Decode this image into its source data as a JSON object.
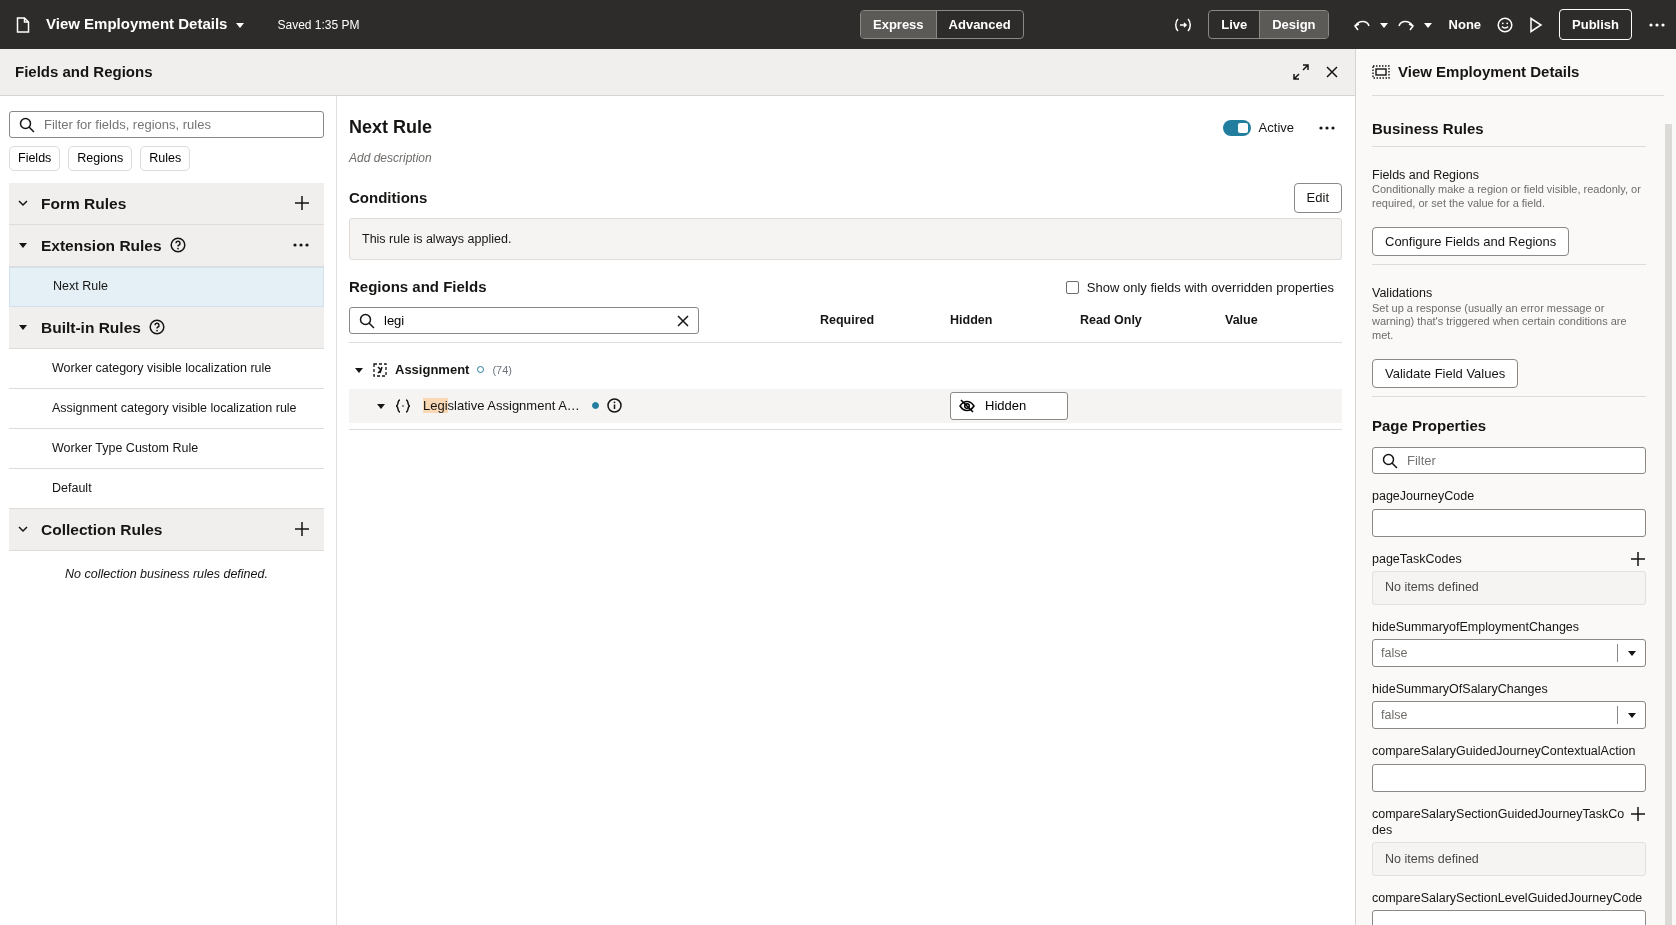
{
  "top_bar": {
    "title": "View Employment Details",
    "saved": "Saved 1:35 PM",
    "modes": [
      {
        "label": "Express",
        "selected": true
      },
      {
        "label": "Advanced",
        "selected": false
      }
    ],
    "views": [
      {
        "label": "Live",
        "selected": false
      },
      {
        "label": "Design",
        "selected": true
      }
    ],
    "language": "None",
    "publish": "Publish"
  },
  "panel": {
    "title": "Fields and Regions"
  },
  "left": {
    "filter_placeholder": "Filter for fields, regions, rules",
    "chips": [
      "Fields",
      "Regions",
      "Rules"
    ],
    "groups": [
      {
        "title": "Form Rules",
        "expanded": true,
        "children": [
          {
            "title": "Extension Rules",
            "expanded": true,
            "help": true,
            "menu": true,
            "items": [
              {
                "label": "Next Rule",
                "selected": true
              }
            ]
          },
          {
            "title": "Built-in Rules",
            "expanded": true,
            "help": true,
            "menu": false,
            "items": [
              {
                "label": "Worker category visible localization rule",
                "selected": false
              },
              {
                "label": "Assignment category visible localization rule",
                "selected": false
              },
              {
                "label": "Worker Type Custom Rule",
                "selected": false
              },
              {
                "label": "Default",
                "selected": false
              }
            ]
          }
        ]
      },
      {
        "title": "Collection Rules",
        "expanded": true,
        "empty": "No collection business rules defined."
      }
    ]
  },
  "center": {
    "title": "Next Rule",
    "active": true,
    "active_label": "Active",
    "description_placeholder": "Add description",
    "conditions_title": "Conditions",
    "edit": "Edit",
    "condition_text": "This rule is always applied.",
    "regions_title": "Regions and Fields",
    "override_label": "Show only fields with overridden properties",
    "override_checked": false,
    "search_value": "legi",
    "columns": [
      "Required",
      "Hidden",
      "Read Only",
      "Value"
    ],
    "tree": [
      {
        "label": "Assignment",
        "count": "(74)",
        "expanded": true,
        "overridden": false,
        "children": [
          {
            "label_match": "Legi",
            "label_rest": "slative Assignment A…",
            "expanded": true,
            "overridden": true,
            "hidden_button": "Hidden"
          }
        ]
      }
    ]
  },
  "right": {
    "title": "View Employment Details",
    "business_rules": "Business Rules",
    "sections": [
      {
        "title": "Fields and Regions",
        "description": "Conditionally make a region or field visible, readonly, or required, or set the value for a field.",
        "button": "Configure Fields and Regions"
      },
      {
        "title": "Validations",
        "description": "Set up a response (usually an error message or warning) that's triggered when certain conditions are met.",
        "button": "Validate Field Values"
      }
    ],
    "page_properties": "Page Properties",
    "filter_placeholder": "Filter",
    "properties": [
      {
        "name": "pageJourneyCode",
        "kind": "text"
      },
      {
        "name": "pageTaskCodes",
        "kind": "list",
        "empty": "No items defined"
      },
      {
        "name": "hideSummaryofEmploymentChanges",
        "kind": "select",
        "value": "false"
      },
      {
        "name": "hideSummaryOfSalaryChanges",
        "kind": "select",
        "value": "false"
      },
      {
        "name": "compareSalaryGuidedJourneyContextualAction",
        "kind": "text"
      },
      {
        "name": "compareSalarySectionGuidedJourneyTaskCodes",
        "kind": "list",
        "empty": "No items defined"
      },
      {
        "name": "compareSalarySectionLevelGuidedJourneyCode",
        "kind": "text"
      }
    ]
  }
}
